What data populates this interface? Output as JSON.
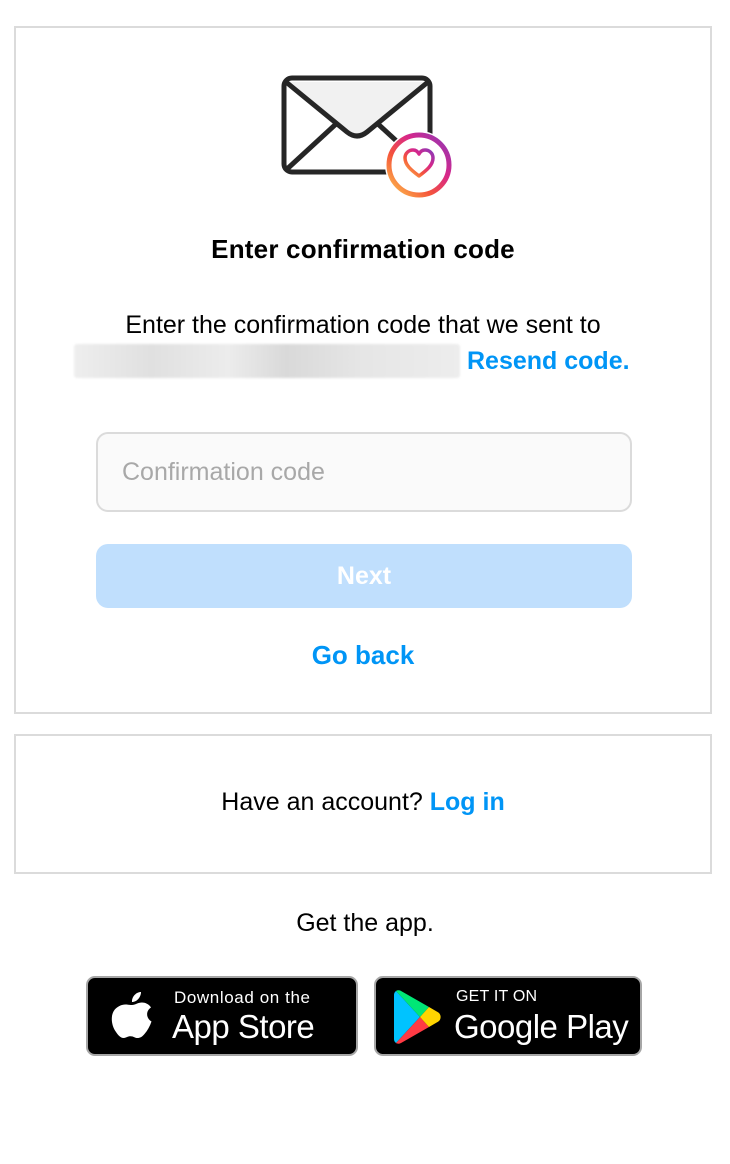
{
  "confirmation": {
    "title": "Enter confirmation code",
    "description": "Enter the confirmation code that we sent to",
    "resend_label": "Resend code.",
    "code_placeholder": "Confirmation code",
    "code_value": "",
    "next_label": "Next",
    "go_back_label": "Go back"
  },
  "login": {
    "prompt": "Have an account?",
    "link_label": "Log in"
  },
  "app": {
    "get_app_label": "Get the app.",
    "apple_small": "Download on the",
    "apple_big": "App Store",
    "google_small": "GET IT ON",
    "google_big": "Google Play"
  },
  "colors": {
    "accent": "#0095f6",
    "button_disabled": "#c0dffd",
    "border": "#dbdbdb",
    "input_background": "#fafafa"
  },
  "icons": {
    "header": "envelope-heart-icon",
    "apple": "apple-logo-icon",
    "google": "google-play-logo-icon"
  }
}
